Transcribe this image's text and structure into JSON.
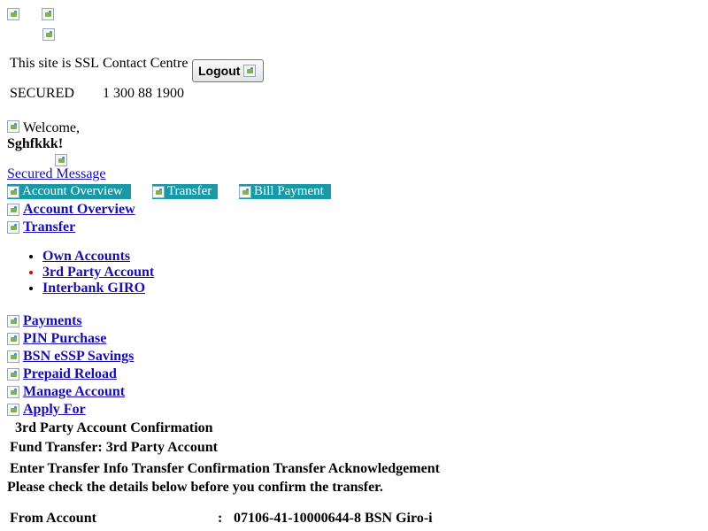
{
  "header": {
    "ssl_line1": "This site is SSL",
    "ssl_line2": "SECURED",
    "contact_label": "Contact Centre",
    "contact_number": "1 300 88 1900",
    "logout_label": "Logout"
  },
  "welcome": {
    "greeting": "Welcome,",
    "username": "Sghfkkk!",
    "secured_message": "Secured Message"
  },
  "tabs": [
    {
      "label": "Account Overview"
    },
    {
      "label": "Transfer"
    },
    {
      "label": "Bill Payment"
    }
  ],
  "nav": {
    "account_overview": "Account Overview",
    "transfer": "Transfer",
    "transfer_sub": [
      "Own Accounts",
      "3rd Party Account",
      "Interbank GIRO"
    ],
    "payments": "Payments",
    "pin_purchase": "PIN Purchase",
    "bsn_essp": "BSN eSSP Savings",
    "prepaid_reload": "Prepaid Reload",
    "manage_account": "Manage Account",
    "apply_for": "Apply For"
  },
  "main": {
    "page_heading": "3rd Party Account Confirmation",
    "subheading": "Fund Transfer: 3rd Party Account",
    "steps": [
      "Enter Transfer Info",
      "Transfer Confirmation",
      "Transfer Acknowledgement"
    ],
    "instruction": "Please check the details below before you confirm the transfer.",
    "from_account_label": "From Account",
    "separator": ":",
    "from_account_value": "07106-41-10000644-8 BSN Giro-i"
  }
}
